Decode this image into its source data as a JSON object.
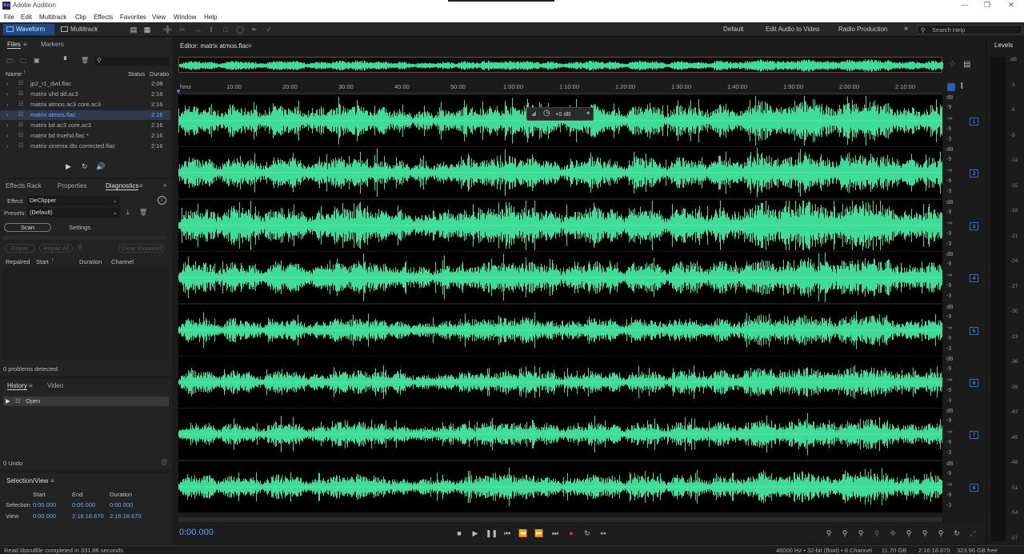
{
  "titlebar": {
    "logo": "Au",
    "title": "Adobe Audition"
  },
  "menu": [
    "File",
    "Edit",
    "Multitrack",
    "Clip",
    "Effects",
    "Favorites",
    "View",
    "Window",
    "Help"
  ],
  "toolbar": {
    "waveform": "Waveform",
    "multitrack": "Multitrack",
    "workspaces": [
      "Default",
      "Edit Audio to Video",
      "Radio Production"
    ],
    "search_placeholder": "Search Help"
  },
  "files_panel": {
    "tabs": [
      "Files",
      "Markers"
    ],
    "columns": {
      "name": "Name",
      "status": "Status",
      "duration": "Duratio"
    },
    "items": [
      {
        "name": "jp2_r1_dvd.flac",
        "dur": "2:08"
      },
      {
        "name": "matrix uhd dd.ac3",
        "dur": "2:16"
      },
      {
        "name": "matrix atmos ac3 core.ac3",
        "dur": "2:16"
      },
      {
        "name": "matrix atmos.flac",
        "dur": "2:16",
        "selected": true
      },
      {
        "name": "matrix bd ac3 core.ac3",
        "dur": "2:16"
      },
      {
        "name": "matrix bd truehd.flac *",
        "dur": "2:16"
      },
      {
        "name": "matrix cinema dts corrected.flac",
        "dur": "2:16"
      }
    ]
  },
  "diag_panel": {
    "tabs": [
      "Effects Rack",
      "Properties",
      "Diagnostics"
    ],
    "effect_label": "Effect:",
    "effect_value": "DeClipper",
    "presets_label": "Presets:",
    "presets_value": "(Default)",
    "scan": "Scan",
    "settings": "Settings",
    "repair": "Repair",
    "repair_all": "Repair All",
    "clear_repaired": "Clear Repaired",
    "cols": {
      "repaired": "Repaired",
      "start": "Start",
      "duration": "Duration",
      "channel": "Channel"
    },
    "problems": "0 problems detected."
  },
  "history_panel": {
    "tabs": [
      "History",
      "Video"
    ],
    "item": "Open",
    "undo": "0 Undo"
  },
  "selection_panel": {
    "title": "Selection/View",
    "cols": {
      "start": "Start",
      "end": "End",
      "duration": "Duration"
    },
    "selection": {
      "label": "Selection",
      "start": "0:00.000",
      "end": "0:00.000",
      "duration": "0:00.000"
    },
    "view": {
      "label": "View",
      "start": "0:00.000",
      "end": "2:16:18.670",
      "duration": "2:16:18.670"
    }
  },
  "editor": {
    "title": "Editor: matrix atmos.flac",
    "ruler_ticks": [
      "hms",
      "10:00",
      "20:00",
      "30:00",
      "40:00",
      "50:00",
      "1:00:00",
      "1:10:00",
      "1:20:00",
      "1:30:00",
      "1:40:00",
      "1:50:00",
      "2:00:00",
      "2:10:00"
    ],
    "hud_value": "+0 dB",
    "channels": [
      "1",
      "2",
      "3",
      "4",
      "5",
      "6",
      "7",
      "8"
    ],
    "db_labels": [
      "dB",
      "-9",
      "-∞",
      "-9",
      "-3"
    ],
    "time": "0:00.000"
  },
  "levels": {
    "title": "Levels",
    "marks": [
      "dB",
      "-3",
      "-6",
      "-9",
      "-12",
      "-15",
      "-18",
      "-21",
      "-24",
      "-27",
      "-30",
      "-33",
      "-36",
      "-39",
      "-42",
      "-45",
      "-48",
      "-51",
      "-54",
      "-57"
    ]
  },
  "statusbar": {
    "left": "Read libsndfile completed in 331.86 seconds",
    "format": "48000 Hz • 32-bit (float) • 8 Channel",
    "size": "11.70 GB",
    "duration": "2:16:18.670",
    "free": "323.96 GB free"
  },
  "colors": {
    "wave": "#3ddc97",
    "accent": "#1f4a84"
  }
}
